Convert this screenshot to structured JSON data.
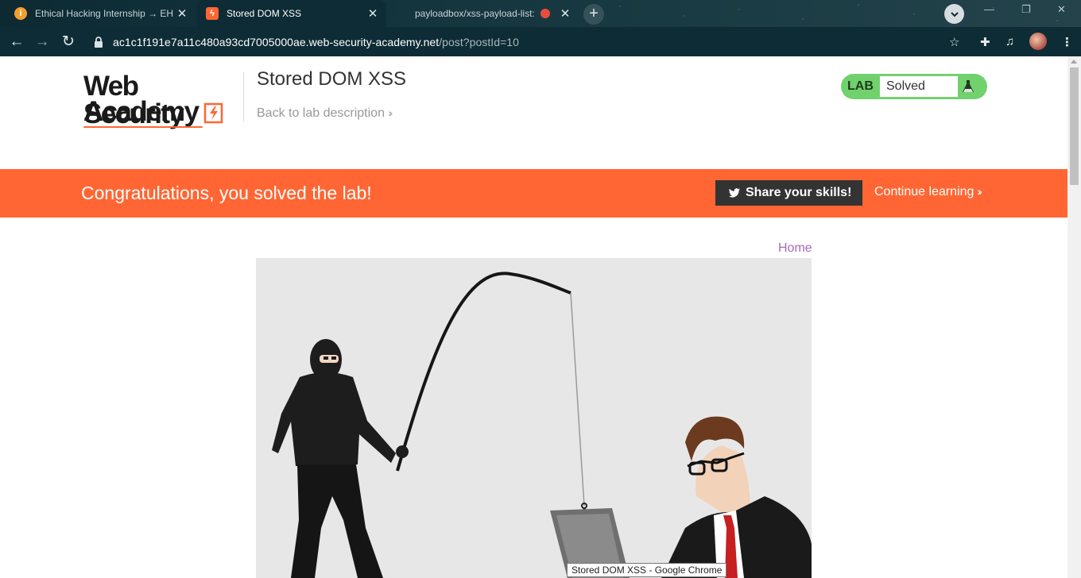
{
  "browser": {
    "tabs": [
      {
        "title": "Ethical Hacking Internship → EH",
        "favicon": "info-circle-icon",
        "favicon_color": "#f29f32",
        "active": false
      },
      {
        "title": "Stored DOM XSS",
        "favicon": "portswigger-lightning-icon",
        "favicon_color": "#ff6633",
        "active": true
      },
      {
        "title": "payloadbox/xss-payload-list:",
        "favicon": "github-icon",
        "favicon_color": "#e94e3c",
        "active": false
      }
    ],
    "url_host": "ac1c1f191e7a11c480a93cd7005000ae.web-security-academy.net",
    "url_path": "/post?postId=10"
  },
  "header": {
    "logo_line1": "Web Security",
    "logo_line2": "Academy",
    "lab_title": "Stored DOM XSS",
    "back_link": "Back to lab description",
    "lab_badge": "LAB",
    "lab_status": "Solved"
  },
  "banner": {
    "message": "Congratulations, you solved the lab!",
    "share_button": "Share your skills!",
    "continue_link": "Continue learning"
  },
  "nav": {
    "home": "Home"
  },
  "tooltip": "Stored DOM XSS - Google Chrome",
  "colors": {
    "accent": "#ff6633",
    "solved_green": "#70d16d",
    "link_purple": "#a46bb5",
    "chrome_frame": "#0e2c35"
  }
}
